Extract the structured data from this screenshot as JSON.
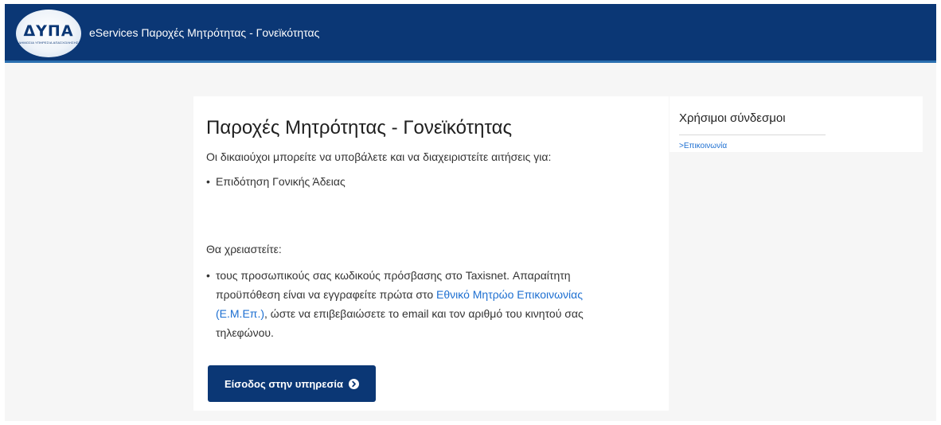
{
  "header": {
    "logo_text": "ΔΥΠΑ",
    "logo_subtitle": "ΔΗΜΟΣΙΑ ΥΠΗΡΕΣΙΑ ΑΠΑΣΧΟΛΗΣΗΣ",
    "title": "eServices Παροχές Μητρότητας - Γονεϊκότητας"
  },
  "main": {
    "title": "Παροχές Μητρότητας - Γονεϊκότητας",
    "intro": "Οι δικαιούχοι μπορείτε να υποβάλετε και να διαχειριστείτε αιτήσεις για:",
    "benefits": [
      "Επιδότηση Γονικής Άδειας"
    ],
    "need_heading": "Θα χρειαστείτε:",
    "requirement": {
      "text_before": "τους προσωπικούς σας κωδικούς πρόσβασης στο Taxisnet. Απαραίτητη προϋπόθεση είναι να εγγραφείτε πρώτα στο ",
      "link": "Εθνικό Μητρώο Επικοινωνίας (Ε.Μ.Επ.)",
      "text_after": ", ώστε να επιβεβαιώσετε το email και τον αριθμό του κινητού σας τηλεφώνου."
    },
    "cta_label": "Είσοδος στην υπηρεσία"
  },
  "sidebar": {
    "title": "Χρήσιμοι σύνδεσμοι",
    "links": [
      ">Επικοινωνία"
    ]
  },
  "colors": {
    "header_bg": "#0b3775",
    "accent_line": "#2a6fb0",
    "link": "#1d6fd1",
    "button_bg": "#0b3775"
  },
  "icons": {
    "cta_icon": "chevron-right-circle-icon"
  }
}
